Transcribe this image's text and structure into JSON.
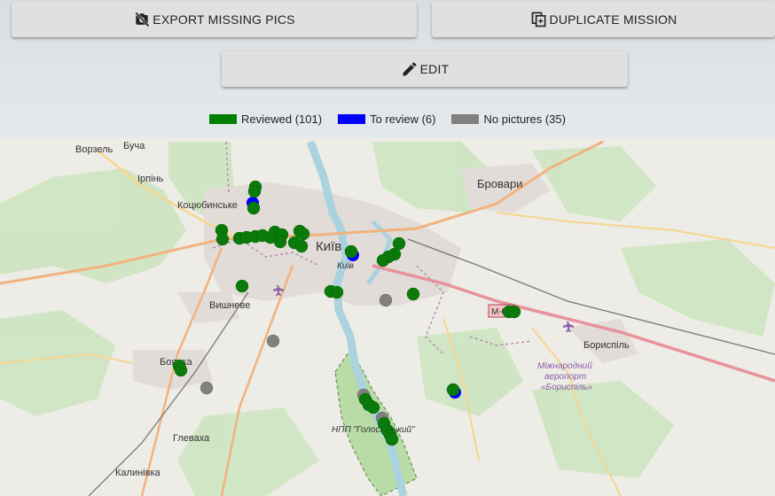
{
  "toolbar": {
    "export_label": "EXPORT MISSING PICS",
    "duplicate_label": "DUPLICATE MISSION",
    "edit_label": "EDIT"
  },
  "legend": {
    "reviewed": {
      "label": "Reviewed (101)",
      "color": "#008000"
    },
    "to_review": {
      "label": "To review (6)",
      "color": "#0000ff"
    },
    "no_pictures": {
      "label": "No pictures (35)",
      "color": "#808080"
    }
  },
  "map": {
    "labels": {
      "vorzel": "Ворзель",
      "bucha": "Буча",
      "irpin": "Ірпінь",
      "kotsiubynske": "Коцюбинське",
      "brovary": "Бровари",
      "kyiv": "Київ",
      "kyiv_sub": "Київ",
      "vyshneve": "Вишневе",
      "boiarka": "Боярка",
      "hlevakha": "Глеваха",
      "kalynivka": "Калинівка",
      "boryspil": "Бориспіль",
      "airport": "Міжнародний аеропорт «Бориспіль»",
      "airport_l1": "Міжнародний",
      "airport_l2": "аеропорт",
      "airport_l3": "«Бориспіль»",
      "park": "НПП \"Голосіївський\"",
      "highway": "М-03"
    }
  }
}
